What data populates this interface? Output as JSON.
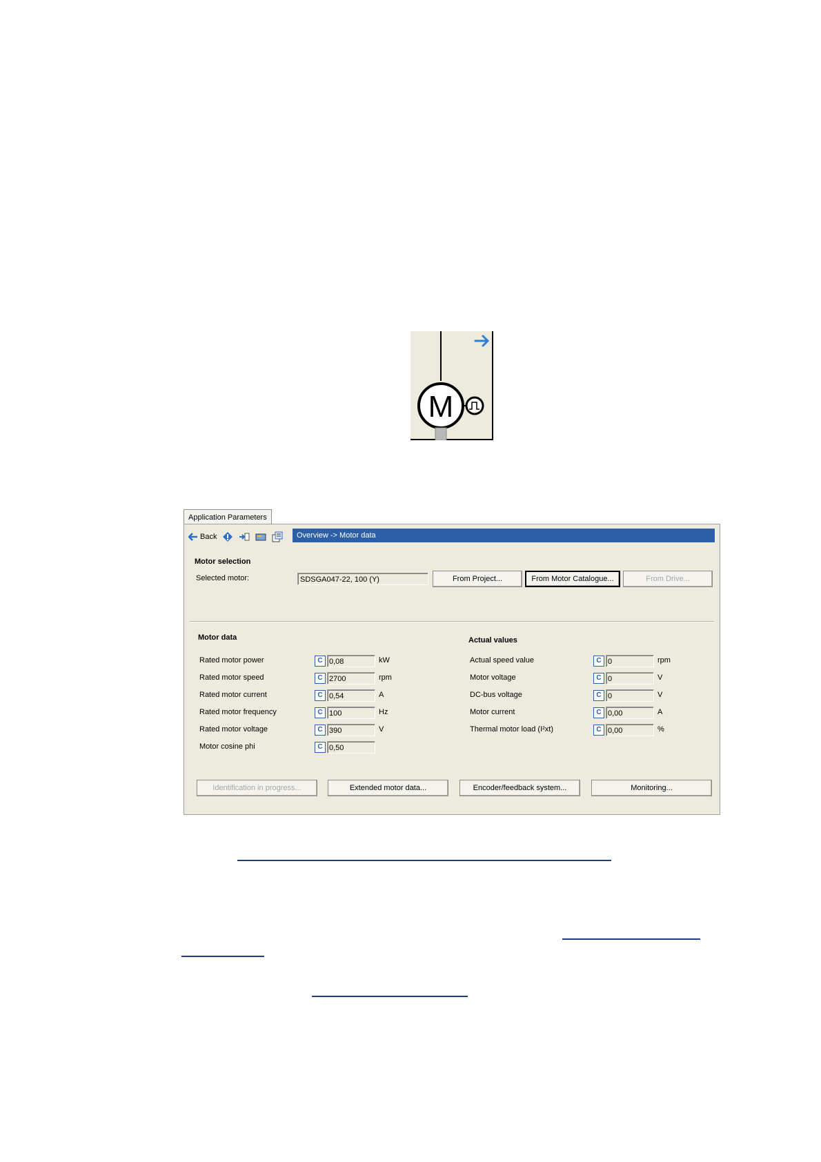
{
  "tab": {
    "label": "Application Parameters"
  },
  "toolbar": {
    "back_label": "Back"
  },
  "breadcrumb": "Overview -> Motor data",
  "motor_selection": {
    "heading": "Motor selection",
    "selected_label": "Selected motor:",
    "selected_value": "SDSGA047-22, 100 (Y)",
    "from_project": "From Project...",
    "from_catalogue": "From Motor Catalogue...",
    "from_drive": "From Drive..."
  },
  "motor_data": {
    "heading": "Motor data",
    "rows": [
      {
        "label": "Rated motor power",
        "value": "0,08",
        "unit": "kW"
      },
      {
        "label": "Rated motor speed",
        "value": "2700",
        "unit": "rpm"
      },
      {
        "label": "Rated motor current",
        "value": "0,54",
        "unit": "A"
      },
      {
        "label": "Rated motor frequency",
        "value": "100",
        "unit": "Hz"
      },
      {
        "label": "Rated motor voltage",
        "value": "390",
        "unit": "V"
      },
      {
        "label": "Motor cosine phi",
        "value": "0,50",
        "unit": ""
      }
    ]
  },
  "actual_values": {
    "heading": "Actual values",
    "rows": [
      {
        "label": "Actual speed value",
        "value": "0",
        "unit": "rpm"
      },
      {
        "label": "Motor voltage",
        "value": "0",
        "unit": "V"
      },
      {
        "label": "DC-bus voltage",
        "value": "0",
        "unit": "V"
      },
      {
        "label": "Motor current",
        "value": "0,00",
        "unit": "A"
      },
      {
        "label": "Thermal motor load (I²xt)",
        "value": "0,00",
        "unit": "%"
      }
    ]
  },
  "badge": "C",
  "bottom_buttons": {
    "identification": "Identification in progress...",
    "extended": "Extended motor data...",
    "encoder": "Encoder/feedback system...",
    "monitoring": "Monitoring..."
  },
  "motor_symbol": {
    "letter": "M"
  },
  "colors": {
    "accent": "#2d5fa8",
    "panel": "#ecebde",
    "link": "#1f3b82"
  }
}
